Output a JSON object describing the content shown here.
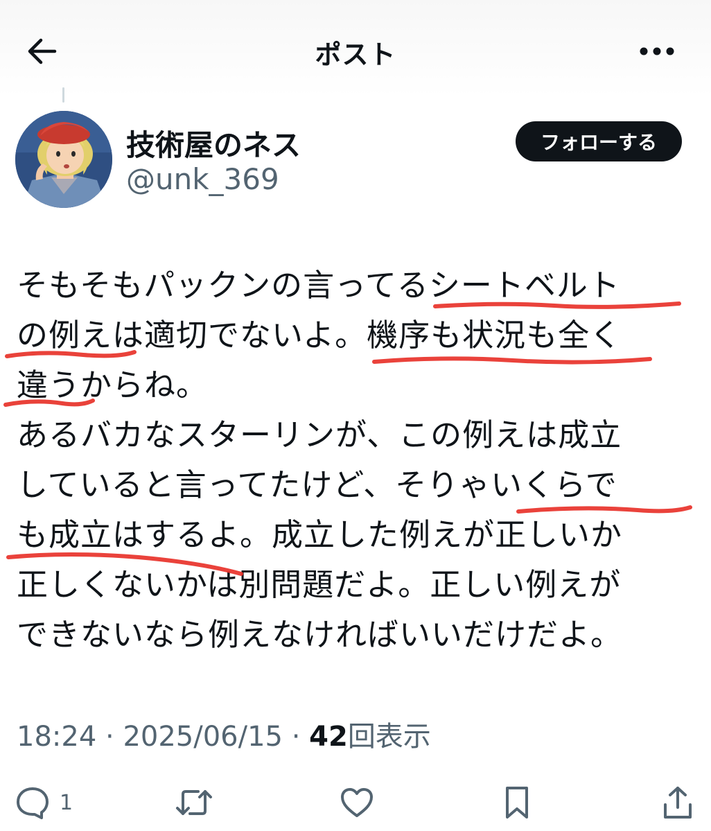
{
  "header": {
    "title": "ポスト"
  },
  "author": {
    "display_name": "技術屋のネス",
    "handle": "@unk_369",
    "follow_label": "フォローする"
  },
  "post": {
    "lines": [
      "そもそもパックンの言ってるシートベルト",
      "の例えは適切でないよ。機序も状況も全く",
      "違うからね。",
      "あるバカなスターリンが、この例えは成立",
      "していると言ってたけど、そりゃいくらで",
      "も成立はするよ。成立した例えが正しいか",
      "正しくないかは別問題だよ。正しい例えが",
      "できないなら例えなければいいだけだよ。"
    ]
  },
  "meta": {
    "time": "18:24",
    "separator": " · ",
    "date": "2025/06/15",
    "views_count": "42",
    "views_label": "回表示"
  },
  "actions": {
    "reply_count": "1"
  },
  "colors": {
    "text": "#0f1419",
    "secondary": "#536471",
    "underline": "#e8322a",
    "follow_bg": "#0f1419"
  },
  "icons": {
    "back": "arrow-left-icon",
    "more": "more-horizontal-icon",
    "reply": "reply-bubble-icon",
    "repost": "repost-arrows-icon",
    "like": "heart-icon",
    "bookmark": "bookmark-icon",
    "share": "share-upload-icon"
  }
}
